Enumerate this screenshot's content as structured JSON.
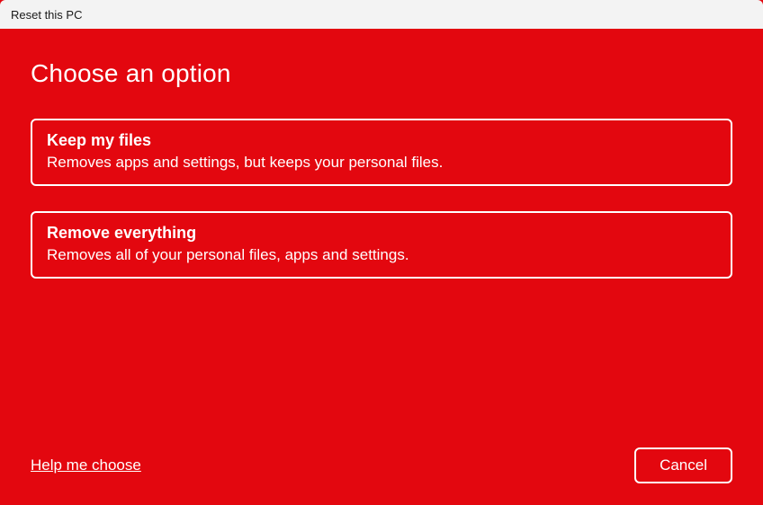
{
  "window": {
    "title": "Reset this PC"
  },
  "page": {
    "heading": "Choose an option"
  },
  "options": [
    {
      "title": "Keep my files",
      "description": "Removes apps and settings, but keeps your personal files."
    },
    {
      "title": "Remove everything",
      "description": "Removes all of your personal files, apps and settings."
    }
  ],
  "footer": {
    "help_label": "Help me choose",
    "cancel_label": "Cancel"
  }
}
